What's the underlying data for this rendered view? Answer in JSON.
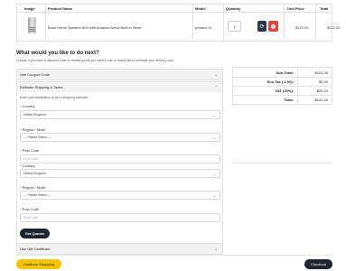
{
  "cart": {
    "headers": {
      "image": "Image",
      "product_name": "Product Name",
      "model": "Model",
      "quantity": "Quantity",
      "unit_price": "Unit Price",
      "total": "Total"
    },
    "items": [
      {
        "product_name": "Bose Home Speaker 500 with Amazon Alexa Built-in Silver",
        "model": "product 11",
        "quantity": "1",
        "unit_price": "$122.20",
        "total": "$122.20"
      }
    ],
    "update_icon": "refresh-icon",
    "remove_icon": "remove-icon"
  },
  "next": {
    "title": "What would you like to do next?",
    "description": "Choose if you have a discount code or reward points you want to use or would like to estimate your delivery cost."
  },
  "coupon": {
    "label": "Use Coupon Code"
  },
  "shipping": {
    "label": "Estimate Shipping & Taxes",
    "intro": "Enter your destination to get a shipping estimate.",
    "country_label": "Country",
    "country_value": "United Kingdom",
    "region_label": "Region / State",
    "region_value": " --- Please Select --- ",
    "postcode_label": "Post Code",
    "postcode_placeholder": "Post Code",
    "country2_label": "Country",
    "country2_value": "United Kingdom",
    "region2_label": "Region / State",
    "region2_value": " --- Please Select --- ",
    "postcode2_label": "Post Code",
    "postcode2_placeholder": "Post Code",
    "get_quotes": "Get Quotes"
  },
  "gift": {
    "label": "Use Gift Certificate"
  },
  "totals": [
    {
      "label": "Sub-Total:",
      "value": "$101.00"
    },
    {
      "label": "Eco Tax (-2.00):",
      "value": "$2.00"
    },
    {
      "label": "VAT (20%):",
      "value": "$20.20"
    },
    {
      "label": "Total:",
      "value": "$122.20"
    }
  ],
  "actions": {
    "continue": "Continue Shopping",
    "checkout": "Checkout"
  },
  "colors": {
    "accent_yellow": "#f5c400",
    "dark": "#1d2530",
    "danger": "#e0463e"
  }
}
